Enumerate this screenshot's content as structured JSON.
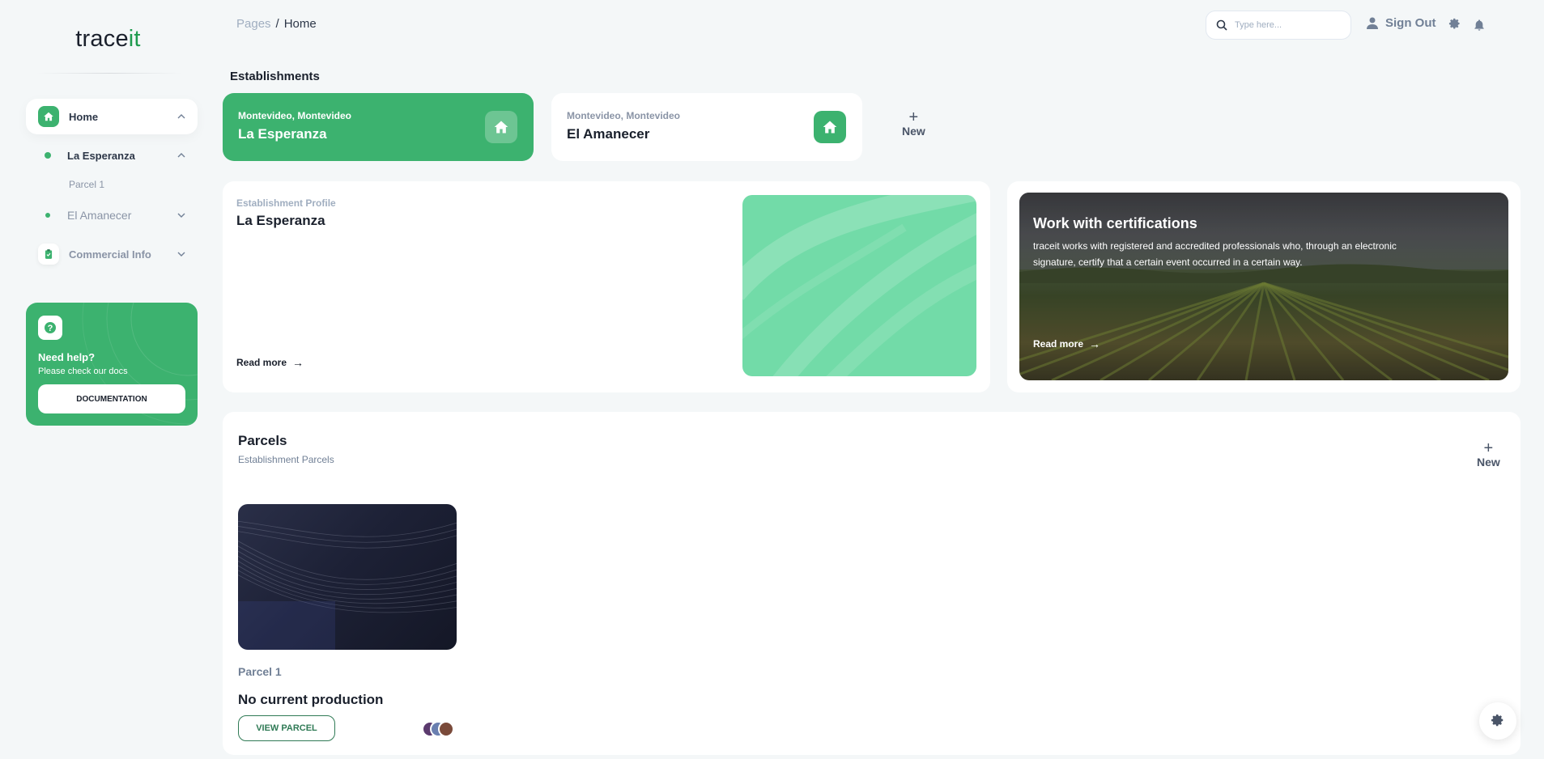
{
  "app": {
    "logo_main": "trace",
    "logo_accent": "it"
  },
  "sidebar": {
    "home": {
      "label": "Home"
    },
    "establishments": [
      {
        "label": "La Esperanza",
        "children": [
          "Parcel 1"
        ]
      },
      {
        "label": "El Amanecer"
      }
    ],
    "commercial": {
      "label": "Commercial Info"
    },
    "help": {
      "title": "Need help?",
      "subtitle": "Please check our docs",
      "button": "DOCUMENTATION"
    }
  },
  "topbar": {
    "breadcrumb": {
      "parent": "Pages",
      "separator": "/",
      "current": "Home"
    },
    "search_placeholder": "Type here...",
    "signout": "Sign Out"
  },
  "establishments": {
    "title": "Establishments",
    "cards": [
      {
        "location": "Montevideo, Montevideo",
        "name": "La Esperanza",
        "active": true
      },
      {
        "location": "Montevideo, Montevideo",
        "name": "El Amanecer",
        "active": false
      }
    ],
    "new_label": "New"
  },
  "profile": {
    "kicker": "Establishment Profile",
    "name": "La Esperanza",
    "read_more": "Read more"
  },
  "certifications": {
    "title": "Work with certifications",
    "text": "traceit works with registered and accredited professionals who, through an electronic signature, certify that a certain event occurred in a certain way.",
    "read_more": "Read more"
  },
  "parcels": {
    "title": "Parcels",
    "subtitle": "Establishment Parcels",
    "new_label": "New",
    "items": [
      {
        "name": "Parcel 1",
        "status": "No current production",
        "button": "VIEW PARCEL"
      }
    ]
  },
  "colors": {
    "brand": "#3cb26f",
    "brand_dark": "#2f7a55",
    "text": "#2d3748",
    "muted": "#8a94a6"
  },
  "icons": [
    "home-icon",
    "chevron-up-icon",
    "chevron-down-icon",
    "clipboard-icon",
    "question-icon",
    "search-icon",
    "user-icon",
    "gear-icon",
    "bell-icon",
    "plus-icon",
    "arrow-right-icon"
  ]
}
